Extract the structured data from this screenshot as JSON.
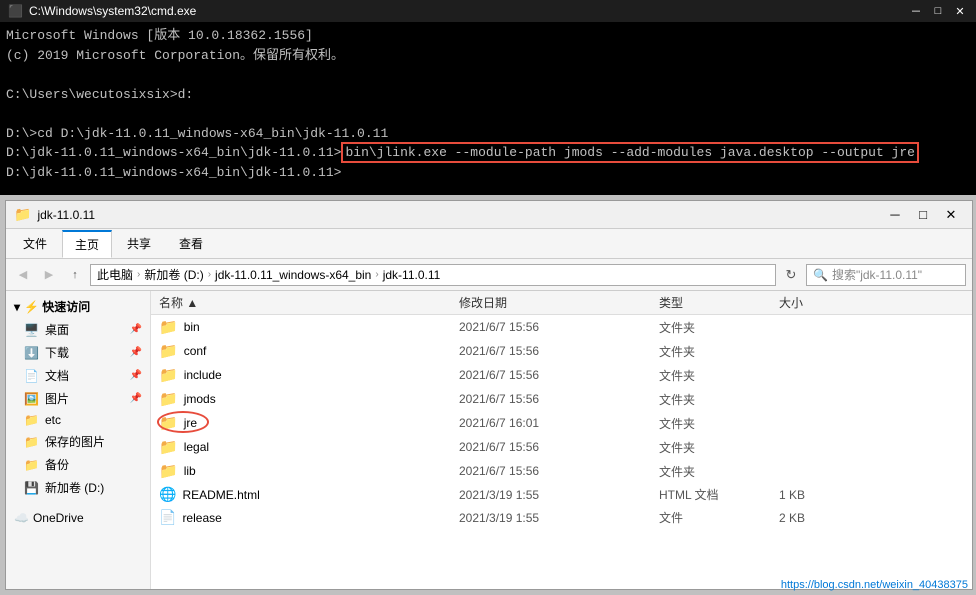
{
  "cmd": {
    "title": "C:\\Windows\\system32\\cmd.exe",
    "lines": [
      "Microsoft Windows [版本 10.0.18362.1556]",
      "(c) 2019 Microsoft Corporation。保留所有权利。",
      "",
      "C:\\Users\\wecutosixsix>d:",
      "",
      "D:\\>cd D:\\jdk-11.0.11_windows-x64_bin\\jdk-11.0.11",
      ""
    ],
    "highlighted_line": "D:\\jdk-11.0.11_windows-x64_bin\\jdk-11.0.11>bin\\jlink.exe --module-path jmods --add-modules java.desktop --output jre",
    "prompt_after": "D:\\jdk-11.0.11_windows-x64_bin\\jdk-11.0.11>"
  },
  "explorer": {
    "title": "jdk-11.0.11",
    "ribbon_tabs": [
      "文件",
      "主页",
      "共享",
      "查看"
    ],
    "active_tab": "主页",
    "path_segments": [
      "此电脑",
      "新加卷 (D:)",
      "jdk-11.0.11_windows-x64_bin",
      "jdk-11.0.11"
    ],
    "search_placeholder": "搜索\"jdk-11.0.11\"",
    "columns": [
      "名称",
      "修改日期",
      "类型",
      "大小"
    ],
    "files": [
      {
        "name": "bin",
        "date": "2021/6/7 15:56",
        "type": "文件夹",
        "size": "",
        "icon": "folder"
      },
      {
        "name": "conf",
        "date": "2021/6/7 15:56",
        "type": "文件夹",
        "size": "",
        "icon": "folder"
      },
      {
        "name": "include",
        "date": "2021/6/7 15:56",
        "type": "文件夹",
        "size": "",
        "icon": "folder"
      },
      {
        "name": "jmods",
        "date": "2021/6/7 15:56",
        "type": "文件夹",
        "size": "",
        "icon": "folder"
      },
      {
        "name": "jre",
        "date": "2021/6/7 16:01",
        "type": "文件夹",
        "size": "",
        "icon": "folder",
        "highlighted": true
      },
      {
        "name": "legal",
        "date": "2021/6/7 15:56",
        "type": "文件夹",
        "size": "",
        "icon": "folder"
      },
      {
        "name": "lib",
        "date": "2021/6/7 15:56",
        "type": "文件夹",
        "size": "",
        "icon": "folder"
      },
      {
        "name": "README.html",
        "date": "2021/3/19 1:55",
        "type": "HTML 文档",
        "size": "1 KB",
        "icon": "html"
      },
      {
        "name": "release",
        "date": "2021/3/19 1:55",
        "type": "文件",
        "size": "2 KB",
        "icon": "file"
      }
    ],
    "sidebar": {
      "quick_access": "快速访问",
      "items": [
        {
          "label": "桌面",
          "icon": "🖥️",
          "pinned": true
        },
        {
          "label": "下载",
          "icon": "⬇️",
          "pinned": true
        },
        {
          "label": "文档",
          "icon": "📄",
          "pinned": true
        },
        {
          "label": "图片",
          "icon": "🖼️",
          "pinned": true
        },
        {
          "label": "etc",
          "icon": "📁"
        },
        {
          "label": "保存的图片",
          "icon": "📁"
        },
        {
          "label": "备份",
          "icon": "📁"
        },
        {
          "label": "新加卷 (D:)",
          "icon": "💾"
        }
      ],
      "onedrive": "OneDrive"
    }
  },
  "watermark": "https://blog.csdn.net/weixin_40438375"
}
